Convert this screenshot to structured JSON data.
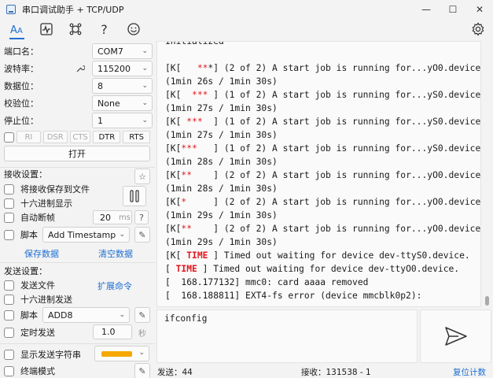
{
  "window": {
    "title": "串口调试助手 + TCP/UDP",
    "minimize": "—",
    "maximize": "☐",
    "close": "✕"
  },
  "toolbar": {
    "items": [
      "text-view",
      "waveform",
      "plugin",
      "help",
      "emoji"
    ],
    "help_label": "?",
    "accent": "#1f6fd1"
  },
  "serial": {
    "port_label": "端口名：",
    "port_value": "COM7",
    "baud_label": "波特率：",
    "baud_value": "115200",
    "databits_label": "数据位：",
    "databits_value": "8",
    "parity_label": "校验位：",
    "parity_value": "None",
    "stopbits_label": "停止位：",
    "stopbits_value": "1",
    "signals": [
      "RI",
      "DSR",
      "CTS",
      "DTR",
      "RTS"
    ],
    "open_button": "打开"
  },
  "receive": {
    "section_title": "接收设置：",
    "save_to_file": "将接收保存到文件",
    "hex_display": "十六进制显示",
    "auto_frame": "自动断帧",
    "auto_frame_value": "20",
    "auto_frame_unit": "ms",
    "help": "?",
    "script": "脚本",
    "script_select": "Add Timestamp",
    "save_data": "保存数据",
    "clear_data": "清空数据"
  },
  "send": {
    "section_title": "发送设置：",
    "send_file": "发送文件",
    "extend_cmd": "扩展命令",
    "hex_send": "十六进制发送",
    "script": "脚本",
    "script_select": "ADD8",
    "timed_send": "定时发送",
    "timed_value": "1.0",
    "timed_unit": "秒",
    "show_send_string": "显示发送字符串",
    "terminal_mode": "终端模式",
    "color_swatch": "#f5a800"
  },
  "log": {
    "lines": [
      [
        {
          "t": "initialized"
        }
      ],
      [
        {
          "t": ""
        }
      ],
      [
        {
          "t": "[K[   "
        },
        {
          "t": "**",
          "c": "red"
        },
        {
          "t": "*] (2 of 2) A start job is running for...yO0.device"
        }
      ],
      [
        {
          "t": "(1min 26s / 1min 30s)"
        }
      ],
      [
        {
          "t": "[K[  "
        },
        {
          "t": "***",
          "c": "red"
        },
        {
          "t": " ] (1 of 2) A start job is running for...yS0.device"
        }
      ],
      [
        {
          "t": "(1min 27s / 1min 30s)"
        }
      ],
      [
        {
          "t": "[K[ "
        },
        {
          "t": "***",
          "c": "red"
        },
        {
          "t": "  ] (1 of 2) A start job is running for...yS0.device"
        }
      ],
      [
        {
          "t": "(1min 27s / 1min 30s)"
        }
      ],
      [
        {
          "t": "[K["
        },
        {
          "t": "***",
          "c": "red"
        },
        {
          "t": "   ] (1 of 2) A start job is running for...yS0.device"
        }
      ],
      [
        {
          "t": "(1min 28s / 1min 30s)"
        }
      ],
      [
        {
          "t": "[K["
        },
        {
          "t": "**",
          "c": "red"
        },
        {
          "t": "    ] (2 of 2) A start job is running for...yO0.device"
        }
      ],
      [
        {
          "t": "(1min 28s / 1min 30s)"
        }
      ],
      [
        {
          "t": "[K["
        },
        {
          "t": "*",
          "c": "red"
        },
        {
          "t": "     ] (2 of 2) A start job is running for...yO0.device"
        }
      ],
      [
        {
          "t": "(1min 29s / 1min 30s)"
        }
      ],
      [
        {
          "t": "[K["
        },
        {
          "t": "**",
          "c": "red"
        },
        {
          "t": "    ] (2 of 2) A start job is running for...yO0.device"
        }
      ],
      [
        {
          "t": "(1min 29s / 1min 30s)"
        }
      ],
      [
        {
          "t": "[K[ "
        },
        {
          "t": "TIME",
          "c": "red b"
        },
        {
          "t": " ] Timed out waiting for device dev-ttyS0.device."
        }
      ],
      [
        {
          "t": "[ "
        },
        {
          "t": "TIME",
          "c": "red b"
        },
        {
          "t": " ] Timed out waiting for device dev-ttyO0.device."
        }
      ],
      [
        {
          "t": "[  168.177132] mmc0: card aaaa removed"
        }
      ],
      [
        {
          "t": "[  168.188811] EXT4-fs error (device mmcblk0p2):"
        }
      ]
    ]
  },
  "input": {
    "value": "ifconfig"
  },
  "status": {
    "sent": "发送：44",
    "received": "接收：131538 - 1",
    "reset": "复位计数"
  }
}
